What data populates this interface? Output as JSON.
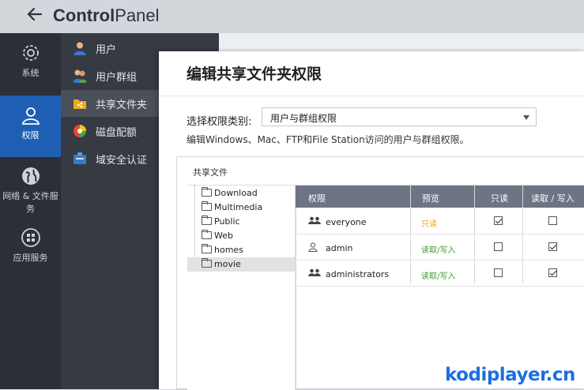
{
  "header": {
    "back_icon": "arrow-left-icon",
    "title_bold": "Control",
    "title_light": "Panel"
  },
  "rail": [
    {
      "label": "系统",
      "icon": "gear-icon"
    },
    {
      "label": "权限",
      "icon": "user-icon",
      "active": true
    },
    {
      "label": "网络 & 文件服务",
      "icon": "globe-icon"
    },
    {
      "label": "应用服务",
      "icon": "grid-icon"
    }
  ],
  "subnav": [
    {
      "label": "用户",
      "icon": "user-icon"
    },
    {
      "label": "用户群组",
      "icon": "user-group-icon"
    },
    {
      "label": "共享文件夹",
      "icon": "shared-folder-icon",
      "active": true
    },
    {
      "label": "磁盘配额",
      "icon": "pie-chart-icon"
    },
    {
      "label": "域安全认证",
      "icon": "domain-icon"
    }
  ],
  "dialog": {
    "title": "编辑共享文件夹权限",
    "select_label": "选择权限类别:",
    "select_value": "用户与群组权限",
    "description": "编辑Windows、Mac、FTP和File Station访问的用户与群组权限。",
    "panel_title": "共享文件",
    "tree": [
      "Download",
      "Multimedia",
      "Public",
      "Web",
      "homes",
      "movie"
    ],
    "tree_selected": "movie",
    "columns": {
      "perm": "权限",
      "preview": "预览",
      "readonly": "只读",
      "readwrite": "读取 / 写入"
    },
    "rows": [
      {
        "name": "everyone",
        "icon": "user-group-icon",
        "preview": "只读",
        "readonly": true,
        "readwrite": false,
        "color": "#e0a31a"
      },
      {
        "name": "admin",
        "icon": "user-icon",
        "preview": "读取/写入",
        "readonly": false,
        "readwrite": true,
        "color": "#3c9a2e"
      },
      {
        "name": "administrators",
        "icon": "user-group-icon",
        "preview": "读取/写入",
        "readonly": false,
        "readwrite": true,
        "color": "#3c9a2e"
      }
    ]
  },
  "watermark": "kodiplayer.cn",
  "colors": {
    "accent": "#1f5fb3",
    "rail_bg": "#2b2f37",
    "subnav_bg": "#353a43",
    "grid_header": "#6d7484",
    "readonly": "#e0a31a",
    "readwrite": "#3c9a2e"
  }
}
